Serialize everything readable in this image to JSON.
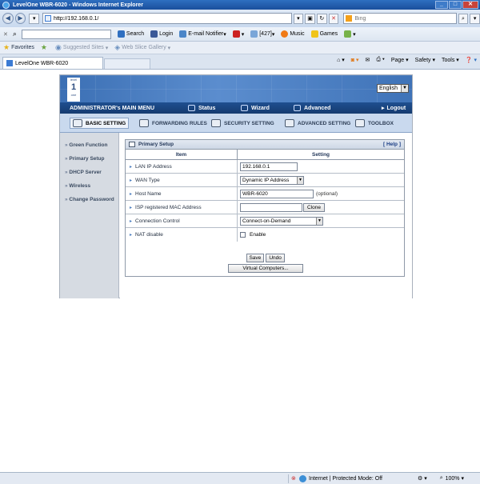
{
  "window": {
    "title": "LevelOne WBR-6020 - Windows Internet Explorer"
  },
  "address_bar": {
    "url": "http://192.168.0.1/",
    "search_placeholder": "Bing"
  },
  "toolbar": {
    "search_label": "Search",
    "login_label": "Login",
    "email_label": "E-mail Notifier",
    "count_label": "[427]",
    "music_label": "Music",
    "games_label": "Games"
  },
  "favorites_bar": {
    "favorites_label": "Favorites",
    "suggested_label": "Suggested Sites",
    "webslice_label": "Web Slice Gallery"
  },
  "tab": {
    "title": "LevelOne WBR-6020"
  },
  "command_bar": {
    "page_label": "Page",
    "safety_label": "Safety",
    "tools_label": "Tools"
  },
  "router": {
    "language": "English",
    "logo_text": "level one",
    "main_menu": {
      "admin_label": "ADMINISTRATOR's MAIN MENU",
      "status": "Status",
      "wizard": "Wizard",
      "advanced": "Advanced",
      "logout": "Logout"
    },
    "tabs": {
      "basic": "BASIC SETTING",
      "forwarding": "FORWARDING RULES",
      "security": "SECURITY SETTING",
      "advanced": "ADVANCED SETTING",
      "toolbox": "TOOLBOX"
    },
    "sidebar": [
      {
        "label": "Green Function"
      },
      {
        "label": "Primary Setup"
      },
      {
        "label": "DHCP Server"
      },
      {
        "label": "Wireless"
      },
      {
        "label": "Change Password"
      }
    ],
    "panel": {
      "title": "Primary Setup",
      "help": "[ Help ]",
      "col_item": "Item",
      "col_setting": "Setting",
      "rows": {
        "lan_ip": {
          "label": "LAN IP Address",
          "value": "192.168.0.1"
        },
        "wan_type": {
          "label": "WAN Type",
          "value": "Dynamic IP Address"
        },
        "host_name": {
          "label": "Host Name",
          "value": "WBR-6020",
          "hint": "(optional)"
        },
        "mac": {
          "label": "ISP registered MAC Address",
          "value": "",
          "button": "Clone"
        },
        "conn_control": {
          "label": "Connection Control",
          "value": "Connect-on-Demand"
        },
        "nat": {
          "label": "NAT disable",
          "checkbox_label": "Enable",
          "checked": false
        }
      },
      "buttons": {
        "save": "Save",
        "undo": "Undo",
        "virtual": "Virtual Computers..."
      }
    }
  },
  "status_bar": {
    "zone": "Internet | Protected Mode: Off",
    "zoom": "100%"
  }
}
